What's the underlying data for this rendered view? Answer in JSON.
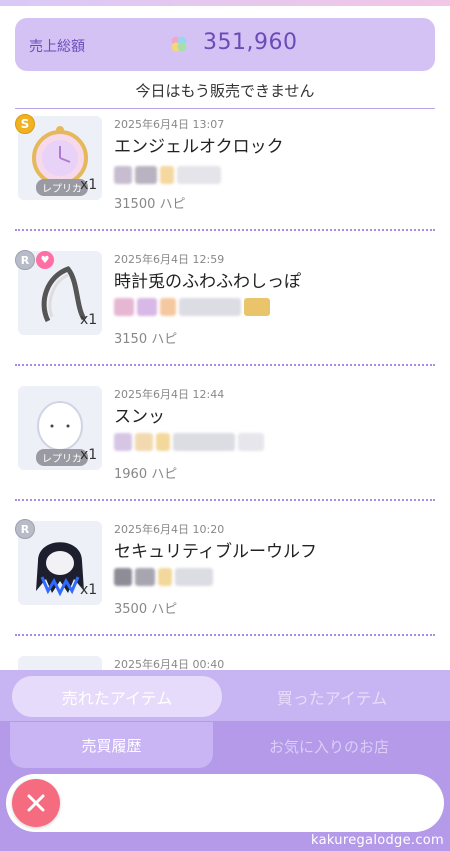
{
  "sales": {
    "label": "売上総額",
    "value": "351,960"
  },
  "notice": "今日はもう販売できません",
  "items": [
    {
      "date": "2025年6月4日 13:07",
      "name": "エンジェルオクロック",
      "price": "31500 ハピ",
      "qty": "x1",
      "badge": "S",
      "replica": "レプリカ"
    },
    {
      "date": "2025年6月4日 12:59",
      "name": "時計兎のふわふわしっぽ",
      "price": "3150 ハピ",
      "qty": "x1",
      "badge": "R"
    },
    {
      "date": "2025年6月4日 12:44",
      "name": "スンッ",
      "price": "1960 ハピ",
      "qty": "x1",
      "replica": "レプリカ"
    },
    {
      "date": "2025年6月4日 10:20",
      "name": "セキュリティブルーウルフ",
      "price": "3500 ハピ",
      "qty": "x1",
      "badge": "R"
    },
    {
      "date": "2025年6月4日 00:40"
    }
  ],
  "tabs": {
    "sold": "売れたアイテム",
    "bought": "買ったアイテム",
    "history": "売買履歴",
    "favorites": "お気に入りのお店"
  },
  "watermark": "kakuregalodge.com",
  "colors": {
    "accent": "#6b4bb8",
    "panel": "#d4c2f5",
    "tab_bg": "#c7b4f2",
    "close": "#f56b80"
  }
}
